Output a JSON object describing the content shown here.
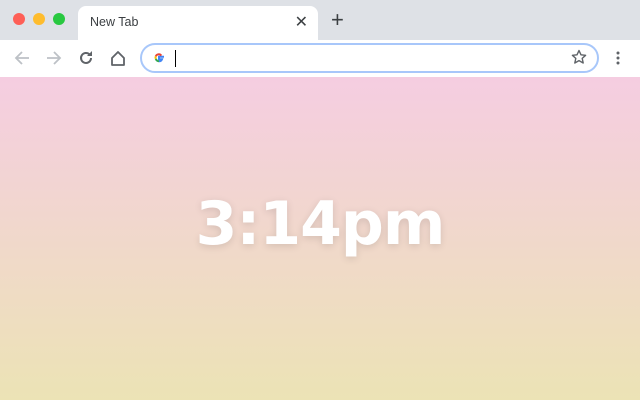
{
  "tab": {
    "title": "New Tab"
  },
  "omnibox": {
    "value": "",
    "placeholder": ""
  },
  "clock": {
    "time": "3:14pm"
  },
  "colors": {
    "gradient_top": "#f5cde1",
    "gradient_bottom": "#ece3b5",
    "omnibox_focus": "#a8c7fa"
  }
}
